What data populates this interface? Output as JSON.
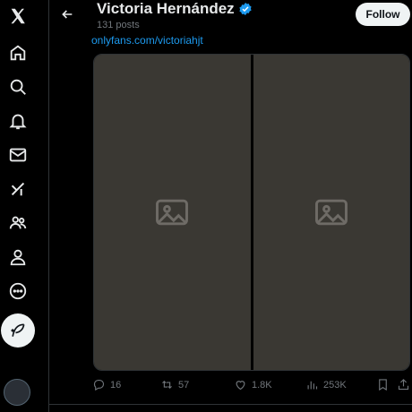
{
  "profile": {
    "name": "Victoria Hernández",
    "post_count": "131 posts",
    "follow_label": "Follow"
  },
  "tweet": {
    "link_text": "onlyfans.com/victoriahjt"
  },
  "media": {
    "count": 2
  },
  "actions": {
    "replies": "16",
    "reposts": "57",
    "likes": "1.8K",
    "views": "253K"
  },
  "colors": {
    "background": "#000000",
    "accent": "#1d9bf0",
    "muted": "#71767b",
    "divider": "#2f3336",
    "button_bg": "#eff3f4"
  },
  "icons": {
    "sidebar": [
      "x-logo-icon",
      "home-icon",
      "search-icon",
      "bell-icon",
      "mail-icon",
      "grok-icon",
      "communities-icon",
      "profile-icon",
      "more-icon"
    ],
    "post_button": "feather-icon",
    "header": [
      "back-arrow-icon",
      "verified-icon"
    ],
    "actions": [
      "reply-icon",
      "repost-icon",
      "like-icon",
      "views-icon",
      "bookmark-icon",
      "share-icon"
    ]
  }
}
